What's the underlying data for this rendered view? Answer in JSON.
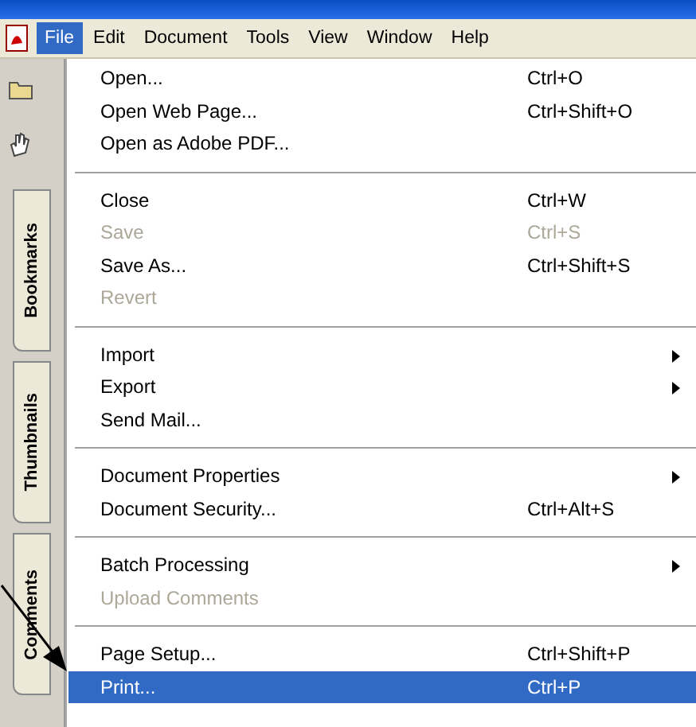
{
  "menubar": [
    {
      "label": "File",
      "selected": true
    },
    {
      "label": "Edit",
      "selected": false
    },
    {
      "label": "Document",
      "selected": false
    },
    {
      "label": "Tools",
      "selected": false
    },
    {
      "label": "View",
      "selected": false
    },
    {
      "label": "Window",
      "selected": false
    },
    {
      "label": "Help",
      "selected": false
    }
  ],
  "side_tabs": [
    {
      "label": "Bookmarks"
    },
    {
      "label": "Thumbnails"
    },
    {
      "label": "Comments"
    }
  ],
  "menu_groups": [
    [
      {
        "label": "Open...",
        "shortcut": "Ctrl+O",
        "submenu": false,
        "disabled": false,
        "selected": false
      },
      {
        "label": "Open Web Page...",
        "shortcut": "Ctrl+Shift+O",
        "submenu": false,
        "disabled": false,
        "selected": false
      },
      {
        "label": "Open as Adobe PDF...",
        "submenu": false,
        "disabled": false,
        "selected": false
      }
    ],
    [
      {
        "label": "Close",
        "shortcut": "Ctrl+W",
        "submenu": false,
        "disabled": false,
        "selected": false
      },
      {
        "label": "Save",
        "shortcut": "Ctrl+S",
        "submenu": false,
        "disabled": true,
        "selected": false
      },
      {
        "label": "Save As...",
        "shortcut": "Ctrl+Shift+S",
        "submenu": false,
        "disabled": false,
        "selected": false
      },
      {
        "label": "Revert",
        "submenu": false,
        "disabled": true,
        "selected": false
      }
    ],
    [
      {
        "label": "Import",
        "submenu": true,
        "disabled": false,
        "selected": false
      },
      {
        "label": "Export",
        "submenu": true,
        "disabled": false,
        "selected": false
      },
      {
        "label": "Send Mail...",
        "submenu": false,
        "disabled": false,
        "selected": false
      }
    ],
    [
      {
        "label": "Document Properties",
        "submenu": true,
        "disabled": false,
        "selected": false
      },
      {
        "label": "Document Security...",
        "shortcut": "Ctrl+Alt+S",
        "submenu": false,
        "disabled": false,
        "selected": false
      }
    ],
    [
      {
        "label": "Batch Processing",
        "submenu": true,
        "disabled": false,
        "selected": false
      },
      {
        "label": "Upload Comments",
        "submenu": false,
        "disabled": true,
        "selected": false
      }
    ],
    [
      {
        "label": "Page Setup...",
        "shortcut": "Ctrl+Shift+P",
        "submenu": false,
        "disabled": false,
        "selected": false
      },
      {
        "label": "Print...",
        "shortcut": "Ctrl+P",
        "submenu": false,
        "disabled": false,
        "selected": true
      }
    ]
  ]
}
